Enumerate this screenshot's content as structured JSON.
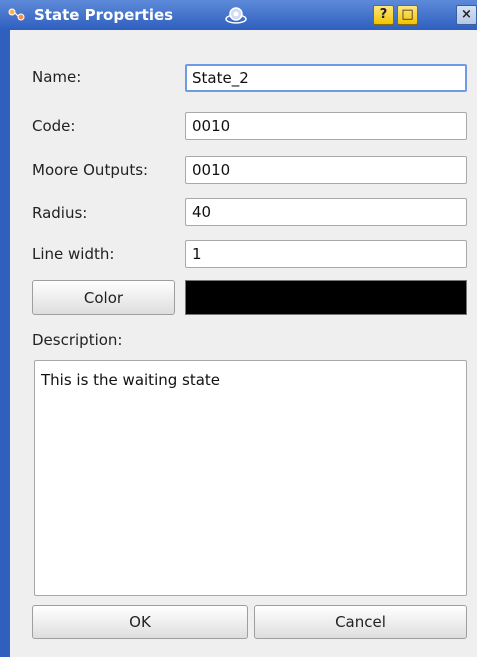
{
  "window": {
    "title": "State Properties",
    "help_label": "?",
    "maximize_label": "□",
    "close_label": "×"
  },
  "form": {
    "name_label": "Name:",
    "name_value": "State_2",
    "code_label": "Code:",
    "code_value": "0010",
    "moore_label": "Moore Outputs:",
    "moore_value": "0010",
    "radius_label": "Radius:",
    "radius_value": "40",
    "linewidth_label": "Line width:",
    "linewidth_value": "1",
    "color_button_label": "Color",
    "color_value": "#000000",
    "description_label": "Description:",
    "description_value": "This is the waiting state"
  },
  "buttons": {
    "ok_label": "OK",
    "cancel_label": "Cancel"
  },
  "colors": {
    "titlebar": "#3a68c6",
    "focus": "#6f9be6",
    "titlebar_button": "#f2c300"
  }
}
